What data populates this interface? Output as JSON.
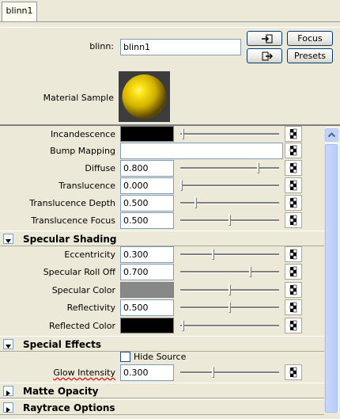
{
  "tab": {
    "label": "blinn1"
  },
  "header": {
    "node_type_label": "blinn:",
    "node_name": "blinn1",
    "focus_label": "Focus",
    "presets_label": "Presets",
    "material_sample_label": "Material Sample"
  },
  "attributes": [
    {
      "label": "Incandescence",
      "kind": "color",
      "color": "#000000",
      "slider": 0.02
    },
    {
      "label": "Bump Mapping",
      "kind": "map"
    },
    {
      "label": "Diffuse",
      "kind": "value",
      "value": "0.800",
      "slider": 0.8
    },
    {
      "label": "Translucence",
      "kind": "value",
      "value": "0.000",
      "slider": 0.0
    },
    {
      "label": "Translucence Depth",
      "kind": "value",
      "value": "0.500",
      "slider": 0.15
    },
    {
      "label": "Translucence Focus",
      "kind": "value",
      "value": "0.500",
      "slider": 0.5
    }
  ],
  "specular": {
    "title": "Specular Shading",
    "rows": [
      {
        "label": "Eccentricity",
        "kind": "value",
        "value": "0.300",
        "slider": 0.33
      },
      {
        "label": "Specular Roll Off",
        "kind": "value",
        "value": "0.700",
        "slider": 0.72
      },
      {
        "label": "Specular Color",
        "kind": "color",
        "color": "#888888",
        "slider": 0.5
      },
      {
        "label": "Reflectivity",
        "kind": "value",
        "value": "0.500",
        "slider": 0.5
      },
      {
        "label": "Reflected Color",
        "kind": "color",
        "color": "#000000",
        "slider": 0.02
      }
    ]
  },
  "special": {
    "title": "Special Effects",
    "hide_source_label": "Hide Source",
    "hide_source_checked": false,
    "glow_label": "Glow Intensity",
    "glow_value": "0.300",
    "glow_slider": 0.33
  },
  "collapsed_sections": [
    "Matte Opacity",
    "Raytrace Options"
  ],
  "colors": {
    "panel": "#ece9d8",
    "field_border": "#7f9db9",
    "scrollbar": "#c1d3fb"
  }
}
